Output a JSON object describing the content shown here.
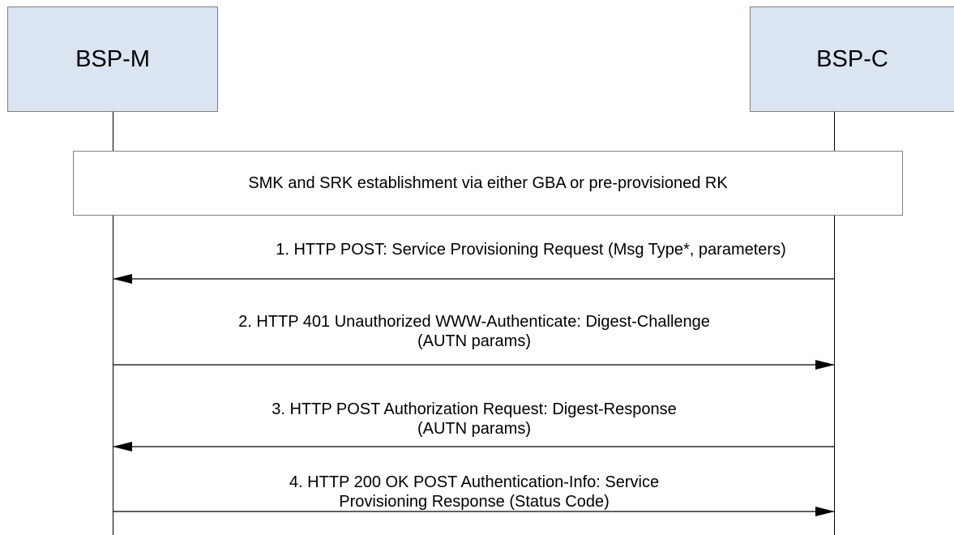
{
  "participants": {
    "left": "BSP-M",
    "right": "BSP-C"
  },
  "setup": {
    "text": "SMK and SRK establishment via either GBA or pre-provisioned RK"
  },
  "messages": [
    {
      "line1": "1.  HTTP POST: Service Provisioning Request (Msg Type*, parameters)",
      "line2": "",
      "from": "BSP-C",
      "to": "BSP-M"
    },
    {
      "line1": "2.  HTTP 401 Unauthorized WWW-Authenticate: Digest-Challenge",
      "line2": "(AUTN params)",
      "from": "BSP-M",
      "to": "BSP-C"
    },
    {
      "line1": "3.  HTTP POST Authorization Request: Digest-Response",
      "line2": "(AUTN params)",
      "from": "BSP-C",
      "to": "BSP-M"
    },
    {
      "line1": "4.  HTTP 200 OK POST Authentication-Info: Service",
      "line2": "Provisioning Response (Status Code)",
      "from": "BSP-M",
      "to": "BSP-C"
    }
  ]
}
